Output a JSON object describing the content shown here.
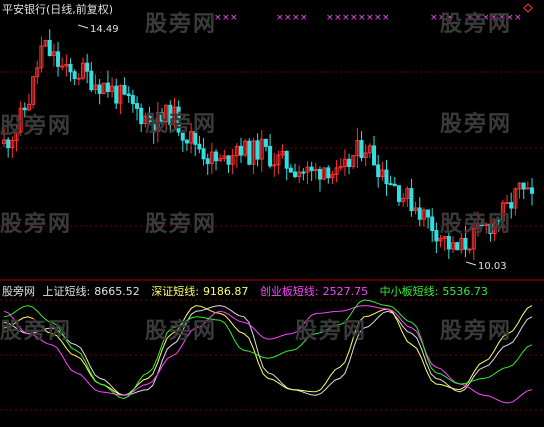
{
  "header": {
    "stock_title": "平安银行(日线,前复权)"
  },
  "price_annotations": {
    "high_label": "14.49",
    "low_label": "10.03"
  },
  "indicator_legend": {
    "source_label": "股旁网",
    "items": [
      {
        "name": "上证短线:",
        "value": "8665.52",
        "color": "#e0e0e0"
      },
      {
        "name": "深证短线:",
        "value": "9186.87",
        "color": "#ffff66"
      },
      {
        "name": "创业板短线:",
        "value": "2527.75",
        "color": "#ff44ff"
      },
      {
        "name": "中小板短线:",
        "value": "5536.73",
        "color": "#33ee33"
      }
    ]
  },
  "watermark": {
    "text": "股旁网"
  },
  "colors": {
    "up_candle": "#ff3030",
    "down_candle": "#30e0e0",
    "grid": "#7a0000",
    "marker": "#ff44ff"
  },
  "icons": {
    "marker_icon": "x-marker",
    "arrow_icon": "left-arrow"
  },
  "chart_data": [
    {
      "type": "candlestick",
      "title": "平安银行(日线,前复权)",
      "annotations": [
        {
          "label": "14.49",
          "kind": "high"
        },
        {
          "label": "10.03",
          "kind": "low"
        }
      ],
      "close_trend": [
        12.3,
        12.6,
        13.2,
        14.2,
        13.9,
        13.6,
        13.7,
        13.5,
        13.4,
        13.2,
        13.0,
        12.8,
        12.7,
        12.9,
        12.5,
        12.3,
        12.0,
        11.9,
        12.3,
        12.1,
        12.2,
        12.0,
        11.9,
        11.8,
        11.7,
        11.9,
        11.6,
        12.0,
        12.3,
        11.9,
        11.6,
        11.3,
        11.1,
        10.8,
        10.5,
        10.2,
        10.4,
        10.6,
        10.8,
        11.0,
        11.4,
        11.2
      ]
    },
    {
      "type": "line",
      "series": [
        {
          "name": "上证短线",
          "color": "#e0e0e0",
          "values": [
            80,
            70,
            75,
            60,
            30,
            15,
            20,
            60,
            90,
            95,
            85,
            35,
            20,
            15,
            30,
            75,
            90,
            70,
            30,
            18,
            40,
            60,
            85
          ]
        },
        {
          "name": "深证短线",
          "color": "#ffff66",
          "values": [
            75,
            85,
            70,
            50,
            25,
            15,
            30,
            70,
            95,
            88,
            70,
            30,
            20,
            18,
            40,
            85,
            92,
            60,
            25,
            20,
            45,
            70,
            95
          ]
        },
        {
          "name": "创业板短线",
          "color": "#ff44ff",
          "values": [
            90,
            70,
            60,
            35,
            18,
            15,
            25,
            50,
            75,
            90,
            80,
            65,
            70,
            88,
            90,
            95,
            92,
            75,
            40,
            25,
            15,
            8,
            20
          ]
        },
        {
          "name": "中小板短线",
          "color": "#33ee33",
          "values": [
            85,
            95,
            80,
            55,
            25,
            12,
            35,
            75,
            85,
            82,
            55,
            48,
            55,
            70,
            78,
            100,
            95,
            80,
            35,
            25,
            30,
            40,
            60
          ]
        }
      ]
    }
  ]
}
